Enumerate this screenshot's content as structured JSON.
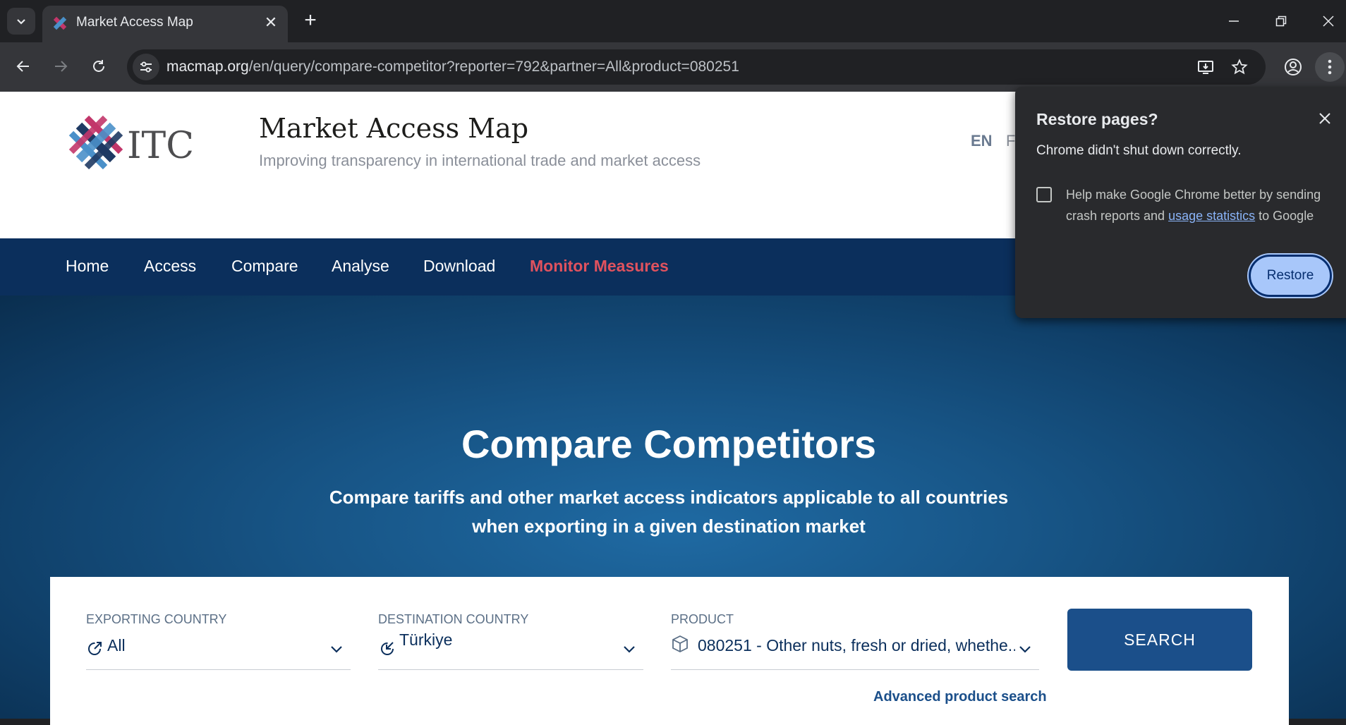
{
  "browser": {
    "tab": {
      "title": "Market Access Map"
    },
    "url": {
      "host": "macmap.org",
      "path": "/en/query/compare-competitor?reporter=792&partner=All&product=080251"
    }
  },
  "site": {
    "logo_text": "ITC",
    "title": "Market Access Map",
    "subtitle": "Improving transparency in international trade and market access",
    "lang_current": "EN",
    "lang_other": "F"
  },
  "nav": {
    "items": [
      "Home",
      "Access",
      "Compare",
      "Analyse",
      "Download",
      "Monitor Measures"
    ]
  },
  "hero": {
    "title": "Compare Competitors",
    "desc_line1": "Compare tariffs and other market access indicators applicable to all countries",
    "desc_line2": "when exporting in a given destination market"
  },
  "search": {
    "exporting": {
      "label": "EXPORTING COUNTRY",
      "value": "All"
    },
    "destination": {
      "label": "DESTINATION COUNTRY",
      "value": "Türkiye"
    },
    "product": {
      "label": "PRODUCT",
      "value": "080251 - Other nuts, fresh or dried, whethe..."
    },
    "button": "SEARCH",
    "advanced": "Advanced product search"
  },
  "restore_popup": {
    "title": "Restore pages?",
    "message": "Chrome didn't shut down correctly.",
    "checkbox_text_before": "Help make Google Chrome better by sending crash reports and ",
    "checkbox_link": "usage statistics",
    "checkbox_text_after": " to Google",
    "button": "Restore"
  },
  "colors": {
    "nav_bg": "#0b2f5c",
    "accent_red": "#e0525e",
    "search_button": "#1b4f8a",
    "restore_button": "#a8c7fa"
  }
}
